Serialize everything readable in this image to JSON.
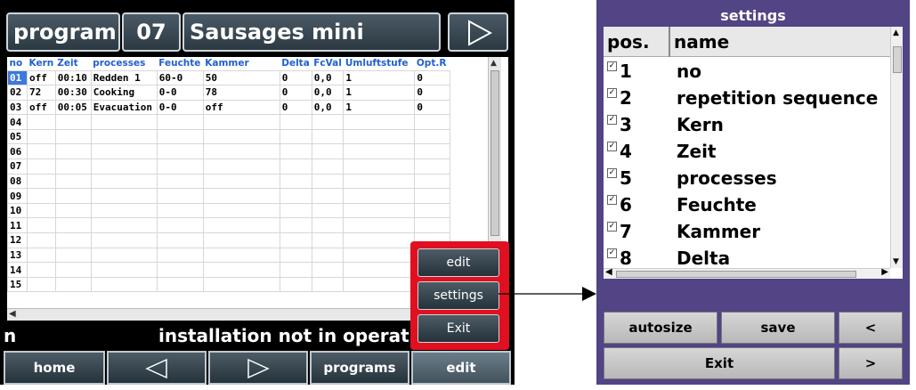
{
  "program_screen": {
    "header": {
      "program_label": "program",
      "program_number": "07",
      "program_name": "Sausages mini"
    },
    "table": {
      "columns": [
        "no",
        "Kern",
        "Zeit",
        "processes",
        "Feuchte",
        "Kammer",
        "Delta",
        "FcVal",
        "Umluftstufe",
        "Opt.R"
      ],
      "rows": [
        [
          "01",
          "off",
          "00:10",
          "Redden 1",
          "60-0",
          "50",
          "0",
          "0,0",
          "1",
          "0"
        ],
        [
          "02",
          "72",
          "00:30",
          "Cooking",
          "0-0",
          "78",
          "0",
          "0,0",
          "1",
          "0"
        ],
        [
          "03",
          "off",
          "00:05",
          "Evacuation",
          "0-0",
          "off",
          "0",
          "0,0",
          "1",
          "0"
        ],
        [
          "04",
          "",
          "",
          "",
          "",
          "",
          "",
          "",
          "",
          ""
        ],
        [
          "05",
          "",
          "",
          "",
          "",
          "",
          "",
          "",
          "",
          ""
        ],
        [
          "06",
          "",
          "",
          "",
          "",
          "",
          "",
          "",
          "",
          ""
        ],
        [
          "07",
          "",
          "",
          "",
          "",
          "",
          "",
          "",
          "",
          ""
        ],
        [
          "08",
          "",
          "",
          "",
          "",
          "",
          "",
          "",
          "",
          ""
        ],
        [
          "09",
          "",
          "",
          "",
          "",
          "",
          "",
          "",
          "",
          ""
        ],
        [
          "10",
          "",
          "",
          "",
          "",
          "",
          "",
          "",
          "",
          ""
        ],
        [
          "11",
          "",
          "",
          "",
          "",
          "",
          "",
          "",
          "",
          ""
        ],
        [
          "12",
          "",
          "",
          "",
          "",
          "",
          "",
          "",
          "",
          ""
        ],
        [
          "13",
          "",
          "",
          "",
          "",
          "",
          "",
          "",
          "",
          ""
        ],
        [
          "14",
          "",
          "",
          "",
          "",
          "",
          "",
          "",
          "",
          ""
        ],
        [
          "15",
          "",
          "",
          "",
          "",
          "",
          "",
          "",
          "",
          ""
        ]
      ],
      "selected_cell": "01"
    },
    "status": {
      "left_char": "n",
      "message": "installation not in operatio"
    },
    "bottom_bar": {
      "home": "home",
      "programs": "programs",
      "edit": "edit"
    },
    "popup_menu": {
      "edit": "edit",
      "settings": "settings",
      "exit": "Exit"
    }
  },
  "settings_screen": {
    "title": "settings",
    "columns": {
      "pos": "pos.",
      "name": "name"
    },
    "items": [
      {
        "pos": "1",
        "name": "no",
        "checked": true
      },
      {
        "pos": "2",
        "name": "repetition sequence",
        "checked": true
      },
      {
        "pos": "3",
        "name": "Kern",
        "checked": true
      },
      {
        "pos": "4",
        "name": "Zeit",
        "checked": true
      },
      {
        "pos": "5",
        "name": "processes",
        "checked": true
      },
      {
        "pos": "6",
        "name": "Feuchte",
        "checked": true
      },
      {
        "pos": "7",
        "name": "Kammer",
        "checked": true
      },
      {
        "pos": "8",
        "name": "Delta",
        "checked": true
      }
    ],
    "buttons": {
      "autosize": "autosize",
      "save": "save",
      "prev": "<",
      "exit": "Exit",
      "next": ">"
    }
  },
  "colors": {
    "popup_bg": "#e01020",
    "settings_bg": "#524485",
    "header_text": "#2060d0",
    "selected_cell": "#3b78e0"
  }
}
